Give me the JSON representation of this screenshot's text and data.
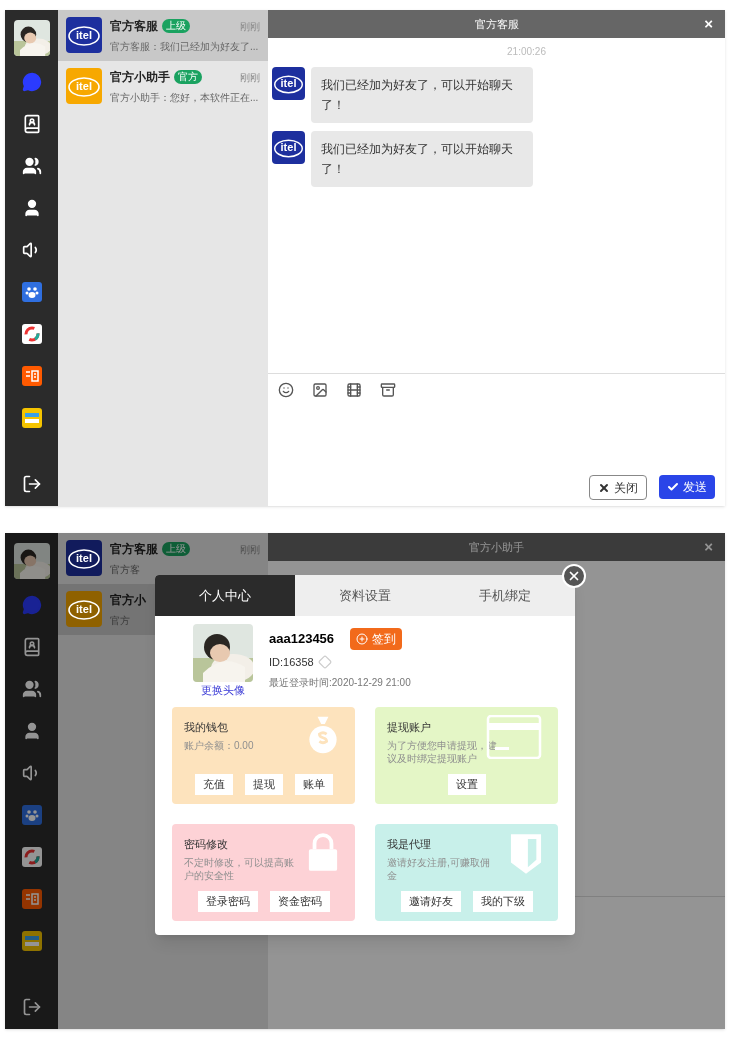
{
  "screens": [
    {
      "sidebar": {
        "items": [
          {
            "kind": "chat",
            "selected": true
          },
          {
            "kind": "contacts",
            "selected": false
          },
          {
            "kind": "groups",
            "selected": false
          },
          {
            "kind": "user",
            "selected": false
          },
          {
            "kind": "speaker",
            "selected": false
          },
          {
            "kind": "paw",
            "selected": false
          },
          {
            "kind": "ring",
            "selected": false
          },
          {
            "kind": "shop",
            "selected": false
          },
          {
            "kind": "tile",
            "selected": false
          }
        ]
      },
      "conversations": [
        {
          "logo": "itel",
          "color": "#1d2f9e",
          "name": "官方客服",
          "badge": "上级",
          "time": "刚刚",
          "preview": "官方客服：我们已经加为好友了...",
          "selected": true
        },
        {
          "logo": "itel",
          "color": "#f7a800",
          "name": "官方小助手",
          "badge": "官方",
          "time": "刚刚",
          "preview": "官方小助手：您好，本软件正在...",
          "selected": false
        }
      ],
      "chat": {
        "title": "官方客服",
        "close": "×",
        "timestamp": "21:00:26",
        "messages": [
          {
            "logo": "itel",
            "text": "我们已经加为好友了，可以开始聊天了！"
          },
          {
            "logo": "itel",
            "text": "我们已经加为好友了，可以开始聊天了！"
          }
        ],
        "buttons": [
          {
            "kind": "close",
            "label": "关闭"
          },
          {
            "kind": "send",
            "label": "发送"
          }
        ]
      }
    },
    {
      "dimmed": true,
      "sidebar": {
        "items": [
          {
            "kind": "chat",
            "selected": true
          },
          {
            "kind": "contacts",
            "selected": false
          },
          {
            "kind": "groups",
            "selected": false
          },
          {
            "kind": "user",
            "selected": false
          },
          {
            "kind": "speaker",
            "selected": false
          },
          {
            "kind": "paw",
            "selected": false
          },
          {
            "kind": "ring",
            "selected": false
          },
          {
            "kind": "shop",
            "selected": false
          },
          {
            "kind": "tile",
            "selected": false
          }
        ]
      },
      "conversations": [
        {
          "logo": "itel",
          "color": "#111b5c",
          "name": "官方客服",
          "badge": "上级",
          "time": "刚刚",
          "preview": "官方客",
          "selected": false
        },
        {
          "logo": "itel",
          "color": "#8f6100",
          "name": "官方小",
          "preview": "官方",
          "selected": true
        }
      ],
      "chat": {
        "title": "官方小助手",
        "close": "×"
      },
      "dialog": {
        "tabs": [
          {
            "label": "个人中心",
            "selected": true
          },
          {
            "label": "资料设置",
            "selected": false
          },
          {
            "label": "手机绑定",
            "selected": false
          }
        ],
        "change_avatar": "更换头像",
        "username": "aaa123456",
        "sign_in": "签到",
        "id": "ID:16358",
        "vip": false,
        "last_login": "最近登录时间:2020-12-29 21:00",
        "cards": [
          {
            "kind": "wallet",
            "color": "#fde3bd",
            "title": "我的钱包",
            "text": "账户余额：0.00",
            "buttons": [
              "充值",
              "提现",
              "账单"
            ]
          },
          {
            "kind": "card",
            "color": "#e4f6c6",
            "title": "提现账户",
            "text": "为了方便您申请提现，建议及时绑定提现账户",
            "buttons": [
              "设置"
            ]
          },
          {
            "kind": "lock",
            "color": "#fdd2d6",
            "title": "密码修改",
            "text": "不定时修改，可以提高账户的安全性",
            "buttons": [
              "登录密码",
              "资金密码"
            ]
          },
          {
            "kind": "shield",
            "color": "#c8f0ea",
            "title": "我是代理",
            "text": "邀请好友注册,可赚取佣金",
            "buttons": [
              "邀请好友",
              "我的下级"
            ]
          }
        ]
      }
    }
  ]
}
